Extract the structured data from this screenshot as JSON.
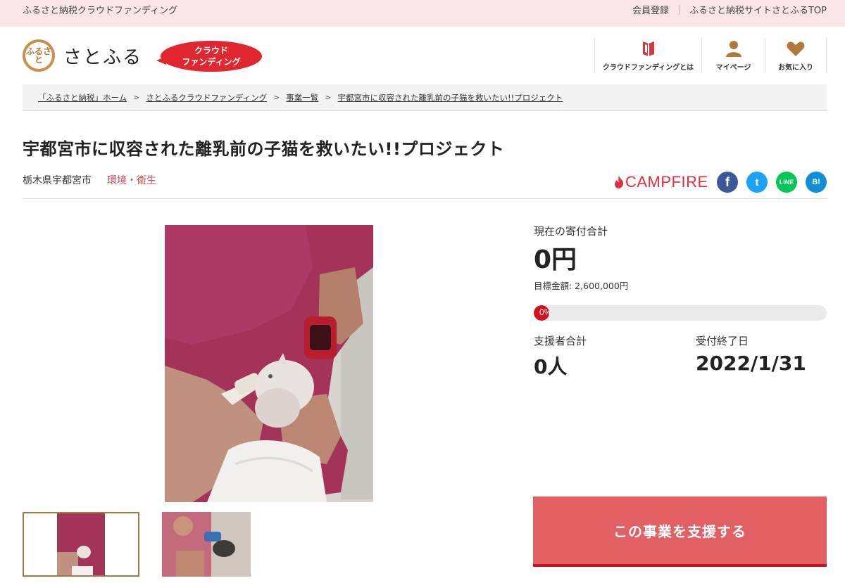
{
  "topbar": {
    "left_link": "ふるさと納税クラウドファンディング",
    "member": "会員登録",
    "site_top": "ふるさと納税サイトさとふるTOP"
  },
  "header": {
    "logo_mark": "ふるさと",
    "logo_text": "さとふる",
    "cf_badge_line1": "クラウド",
    "cf_badge_line2": "ファンディング",
    "nav": [
      {
        "label": "クラウドファンディングとは",
        "icon": "book-icon"
      },
      {
        "label": "マイページ",
        "icon": "user-icon"
      },
      {
        "label": "お気に入り",
        "icon": "heart-icon"
      }
    ]
  },
  "breadcrumb": [
    "「ふるさと納税」ホーム",
    "さとふるクラウドファンディング",
    "事業一覧",
    "宇都宮市に収容された離乳前の子猫を救いたい!!プロジェクト"
  ],
  "project": {
    "title": "宇都宮市に収容された離乳前の子猫を救いたい!!プロジェクト",
    "prefecture": "栃木県宇都宮市",
    "category": "環境・衛生",
    "partner": "CAMPFIRE"
  },
  "share": {
    "facebook": "f",
    "twitter": "t",
    "line": "LINE",
    "hatena": "B!"
  },
  "stats": {
    "current_label": "現在の寄付合計",
    "current_value": "0円",
    "goal_text": "目標金額: 2,600,000円",
    "progress_text": "0%",
    "progress_fraction": 0,
    "supporters_label": "支援者合計",
    "supporters_value": "0人",
    "end_label": "受付終了日",
    "end_value": "2022/1/31"
  },
  "cta": {
    "label": "この事業を支援する"
  },
  "colors": {
    "topbar_bg": "#f9e5e6",
    "accent_red": "#e0262f",
    "button": "#e25f63",
    "category": "#d24a55"
  }
}
